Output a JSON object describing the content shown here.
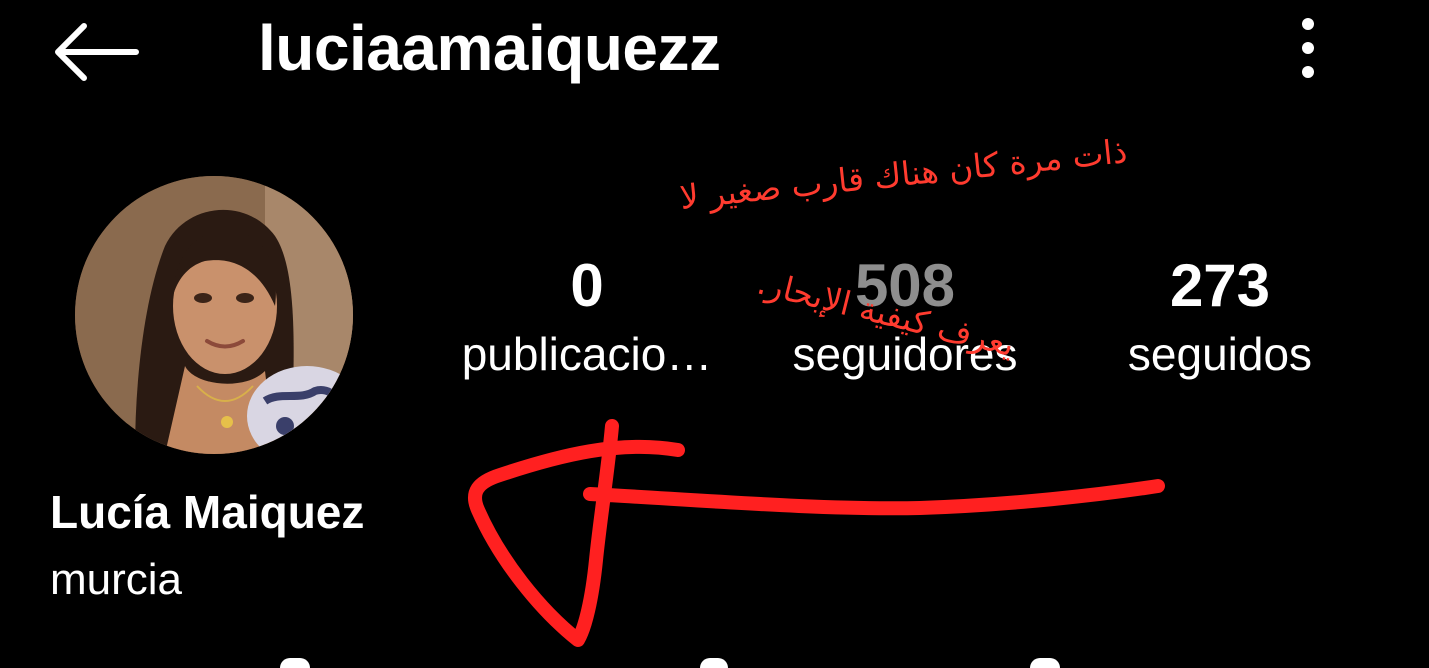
{
  "header": {
    "username": "luciaamaiquezz",
    "back_icon": "arrow-left-icon",
    "more_icon": "more-vertical-icon"
  },
  "profile": {
    "full_name": "Lucía Maiquez",
    "bio": "murcia",
    "avatar": "profile-photo"
  },
  "stats": {
    "posts": {
      "value": "0",
      "label": "publicacio…"
    },
    "followers": {
      "value": "508",
      "label": "seguidores"
    },
    "following": {
      "value": "273",
      "label": "seguidos"
    }
  },
  "annotation": {
    "line1": "ذات مرة كان هناك قارب صغير لا",
    "line2": "يعرف كيفية الإبحار.",
    "color": "#ff3b2f"
  },
  "colors": {
    "background": "#000000",
    "text": "#ffffff",
    "muted": "#8e8e8e",
    "annotation": "#ff3b2f"
  }
}
